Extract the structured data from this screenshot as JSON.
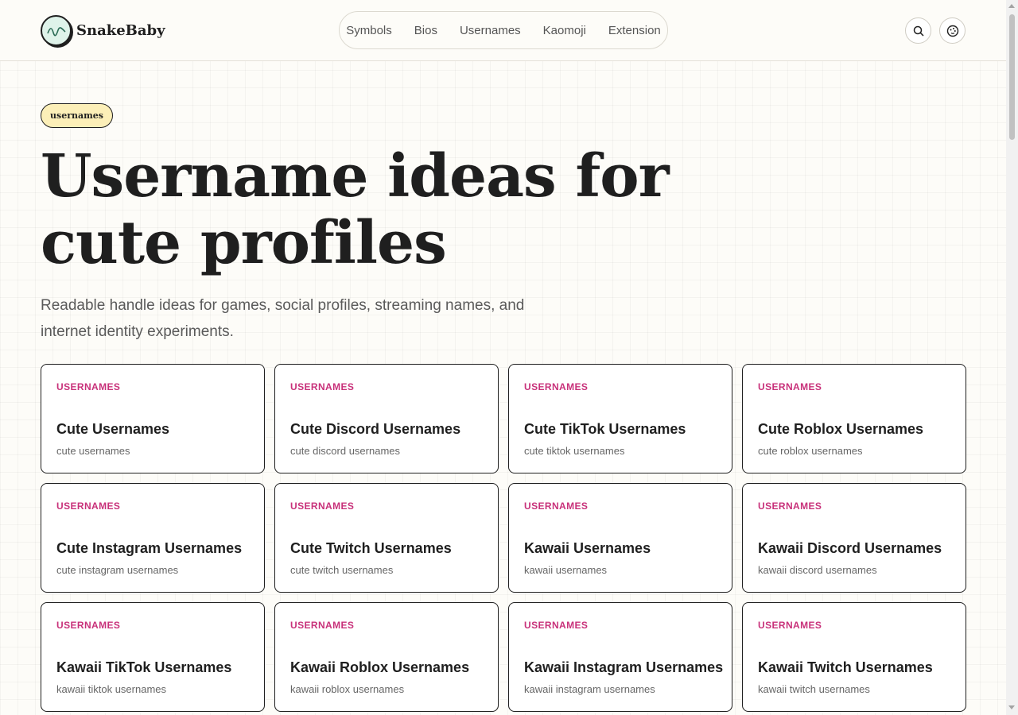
{
  "brand": {
    "name": "SnakeBaby",
    "accent": "#c8317a"
  },
  "nav": {
    "items": [
      {
        "label": "Symbols"
      },
      {
        "label": "Bios"
      },
      {
        "label": "Usernames"
      },
      {
        "label": "Kaomoji"
      },
      {
        "label": "Extension"
      }
    ]
  },
  "header_icons": [
    "search-icon",
    "theme-icon"
  ],
  "hero": {
    "tag": "usernames",
    "title": "Username ideas for cute profiles",
    "subtitle": "Readable handle ideas for games, social profiles, streaming names, and internet identity experiments."
  },
  "cards": [
    {
      "tag": "USERNAMES",
      "title": "Cute Usernames",
      "sub": "cute usernames"
    },
    {
      "tag": "USERNAMES",
      "title": "Cute Discord Usernames",
      "sub": "cute discord usernames"
    },
    {
      "tag": "USERNAMES",
      "title": "Cute TikTok Usernames",
      "sub": "cute tiktok usernames"
    },
    {
      "tag": "USERNAMES",
      "title": "Cute Roblox Usernames",
      "sub": "cute roblox usernames"
    },
    {
      "tag": "USERNAMES",
      "title": "Cute Instagram Usernames",
      "sub": "cute instagram usernames"
    },
    {
      "tag": "USERNAMES",
      "title": "Cute Twitch Usernames",
      "sub": "cute twitch usernames"
    },
    {
      "tag": "USERNAMES",
      "title": "Kawaii Usernames",
      "sub": "kawaii usernames"
    },
    {
      "tag": "USERNAMES",
      "title": "Kawaii Discord Usernames",
      "sub": "kawaii discord usernames"
    },
    {
      "tag": "USERNAMES",
      "title": "Kawaii TikTok Usernames",
      "sub": "kawaii tiktok usernames"
    },
    {
      "tag": "USERNAMES",
      "title": "Kawaii Roblox Usernames",
      "sub": "kawaii roblox usernames"
    },
    {
      "tag": "USERNAMES",
      "title": "Kawaii Instagram Usernames",
      "sub": "kawaii instagram usernames"
    },
    {
      "tag": "USERNAMES",
      "title": "Kawaii Twitch Usernames",
      "sub": "kawaii twitch usernames"
    }
  ]
}
